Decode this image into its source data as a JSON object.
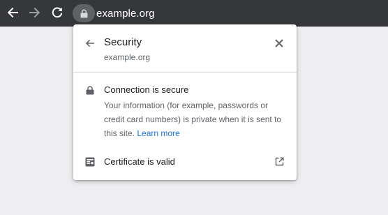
{
  "toolbar": {
    "url": "example.org",
    "icons": {
      "back": "back-arrow-icon",
      "forward": "forward-arrow-icon",
      "reload": "reload-icon",
      "site_info": "lock-icon"
    }
  },
  "popup": {
    "title": "Security",
    "subtitle": "example.org",
    "connection": {
      "title": "Connection is secure",
      "description": "Your information (for example, passwords or credit card numbers) is private when it is sent to this site.",
      "learn_more": "Learn more"
    },
    "certificate": {
      "label": "Certificate is valid"
    }
  },
  "colors": {
    "toolbar_bg": "#35373b",
    "page_bg": "#eeeef1",
    "link": "#1a73e8",
    "text_primary": "#202124",
    "text_secondary": "#5f6368"
  }
}
